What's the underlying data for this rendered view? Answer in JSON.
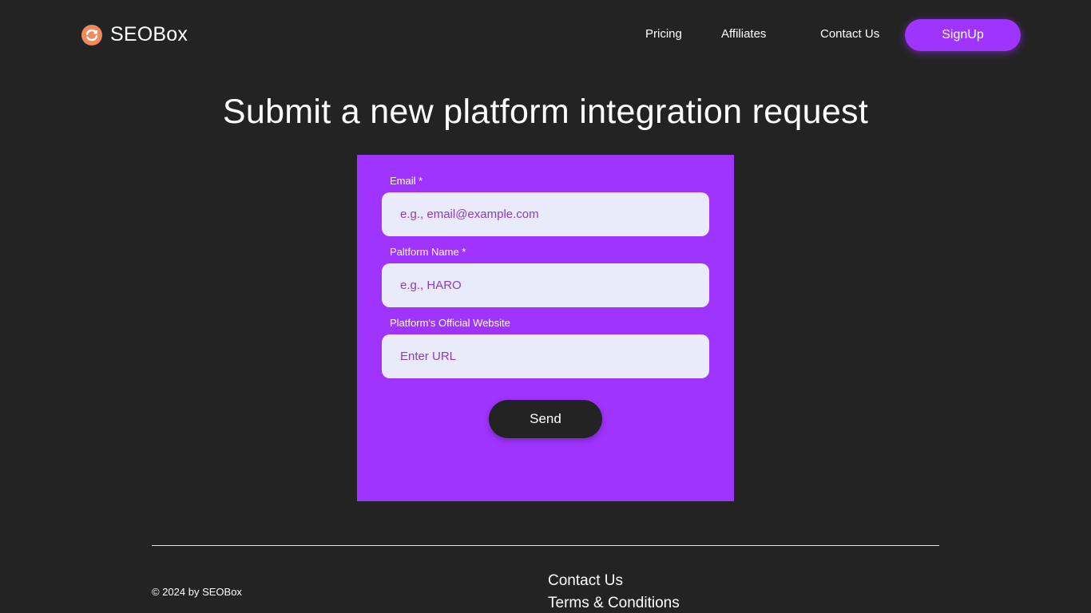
{
  "header": {
    "logo_text": "SEOBox",
    "logo_icon": "refresh-arrows-icon",
    "nav": {
      "pricing": "Pricing",
      "affiliates": "Affiliates",
      "contact": "Contact Us"
    },
    "signup_label": "SignUp"
  },
  "main": {
    "title": "Submit a new platform integration request"
  },
  "form": {
    "email": {
      "label": "Email *",
      "placeholder": "e.g., email@example.com",
      "value": ""
    },
    "platform_name": {
      "label": "Paltform Name *",
      "placeholder": "e.g., HARO",
      "value": ""
    },
    "website": {
      "label": "Platform's Official Website",
      "placeholder": "Enter URL",
      "value": ""
    },
    "send_label": "Send"
  },
  "footer": {
    "copyright": "© 2024 by SEOBox",
    "links": {
      "contact": "Contact Us",
      "terms": "Terms & Conditions"
    }
  },
  "colors": {
    "background": "#232323",
    "accent": "#a034ff",
    "logo": "#f08a5d",
    "input_bg": "#e9ebfb"
  }
}
